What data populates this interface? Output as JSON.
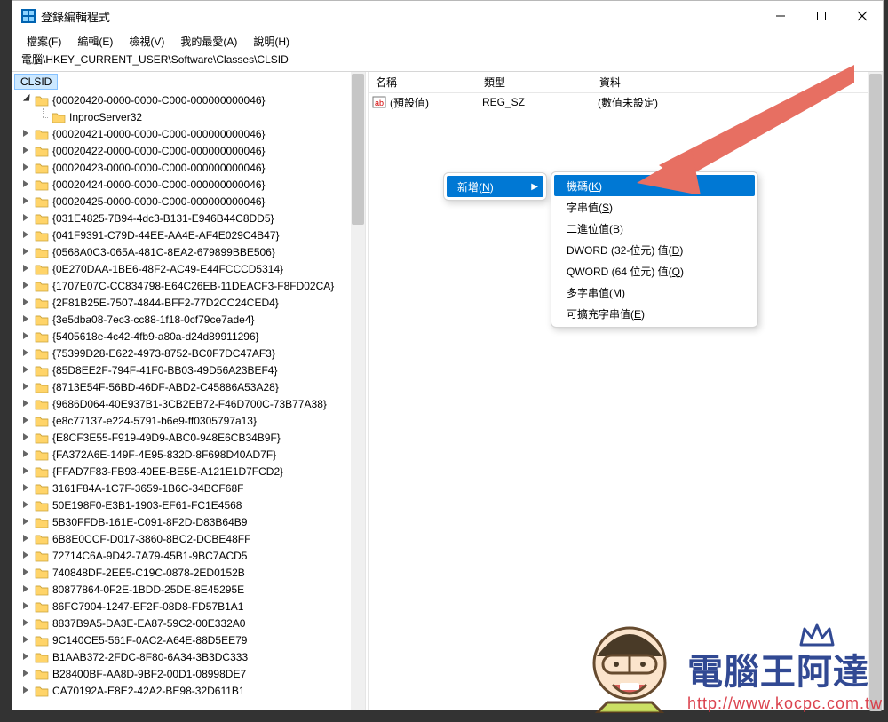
{
  "window": {
    "title": "登錄編輯程式"
  },
  "menubar": {
    "file": "檔案(F)",
    "edit": "編輯(E)",
    "view": "檢視(V)",
    "favorites": "我的最愛(A)",
    "help": "說明(H)"
  },
  "address": "電腦\\HKEY_CURRENT_USER\\Software\\Classes\\CLSID",
  "tree": {
    "selected": "CLSID",
    "items": [
      {
        "label": "{00020420-0000-0000-C000-000000000046}",
        "expanded": true,
        "exp": true
      },
      {
        "label": "InprocServer32",
        "level2": true
      },
      {
        "label": "{00020421-0000-0000-C000-000000000046}",
        "exp": true
      },
      {
        "label": "{00020422-0000-0000-C000-000000000046}",
        "exp": true
      },
      {
        "label": "{00020423-0000-0000-C000-000000000046}",
        "exp": true
      },
      {
        "label": "{00020424-0000-0000-C000-000000000046}",
        "exp": true
      },
      {
        "label": "{00020425-0000-0000-C000-000000000046}",
        "exp": true
      },
      {
        "label": "{031E4825-7B94-4dc3-B131-E946B44C8DD5}",
        "exp": true
      },
      {
        "label": "{041F9391-C79D-44EE-AA4E-AF4E029C4B47}",
        "exp": true
      },
      {
        "label": "{0568A0C3-065A-481C-8EA2-679899BBE506}",
        "exp": true
      },
      {
        "label": "{0E270DAA-1BE6-48F2-AC49-E44FCCCD5314}",
        "exp": true
      },
      {
        "label": "{1707E07C-CC834798-E64C26EB-11DEACF3-F8FD02CA}",
        "exp": true
      },
      {
        "label": "{2F81B25E-7507-4844-BFF2-77D2CC24CED4}",
        "exp": true
      },
      {
        "label": "{3e5dba08-7ec3-cc88-1f18-0cf79ce7ade4}",
        "exp": true
      },
      {
        "label": "{5405618e-4c42-4fb9-a80a-d24d89911296}",
        "exp": true
      },
      {
        "label": "{75399D28-E622-4973-8752-BC0F7DC47AF3}",
        "exp": true
      },
      {
        "label": "{85D8EE2F-794F-41F0-BB03-49D56A23BEF4}",
        "exp": true
      },
      {
        "label": "{8713E54F-56BD-46DF-ABD2-C45886A53A28}",
        "exp": true
      },
      {
        "label": "{9686D064-40E937B1-3CB2EB72-F46D700C-73B77A38}",
        "exp": true
      },
      {
        "label": "{e8c77137-e224-5791-b6e9-ff0305797a13}",
        "exp": true
      },
      {
        "label": "{E8CF3E55-F919-49D9-ABC0-948E6CB34B9F}",
        "exp": true
      },
      {
        "label": "{FA372A6E-149F-4E95-832D-8F698D40AD7F}",
        "exp": true
      },
      {
        "label": "{FFAD7F83-FB93-40EE-BE5E-A121E1D7FCD2}",
        "exp": true
      },
      {
        "label": "3161F84A-1C7F-3659-1B6C-34BCF68F",
        "exp": true
      },
      {
        "label": "50E198F0-E3B1-1903-EF61-FC1E4568",
        "exp": true
      },
      {
        "label": "5B30FFDB-161E-C091-8F2D-D83B64B9",
        "exp": true
      },
      {
        "label": "6B8E0CCF-D017-3860-8BC2-DCBE48FF",
        "exp": true
      },
      {
        "label": "72714C6A-9D42-7A79-45B1-9BC7ACD5",
        "exp": true
      },
      {
        "label": "740848DF-2EE5-C19C-0878-2ED0152B",
        "exp": true
      },
      {
        "label": "80877864-0F2E-1BDD-25DE-8E45295E",
        "exp": true
      },
      {
        "label": "86FC7904-1247-EF2F-08D8-FD57B1A1",
        "exp": true
      },
      {
        "label": "8837B9A5-DA3E-EA87-59C2-00E332A0",
        "exp": true
      },
      {
        "label": "9C140CE5-561F-0AC2-A64E-88D5EE79",
        "exp": true
      },
      {
        "label": "B1AAB372-2FDC-8F80-6A34-3B3DC333",
        "exp": true
      },
      {
        "label": "B28400BF-AA8D-9BF2-00D1-08998DE7",
        "exp": true
      },
      {
        "label": "CA70192A-E8E2-42A2-BE98-32D611B1",
        "exp": true
      }
    ]
  },
  "list": {
    "columns": {
      "name": "名稱",
      "type": "類型",
      "data": "資料"
    },
    "rows": [
      {
        "name": "(預設值)",
        "type": "REG_SZ",
        "data": "(數值未設定)"
      }
    ]
  },
  "context_menu": {
    "new": "新增",
    "new_accel": "N",
    "submenu": [
      {
        "label": "機碼",
        "accel": "K",
        "selected": true
      },
      {
        "label": "字串值",
        "accel": "S"
      },
      {
        "label": "二進位值",
        "accel": "B"
      },
      {
        "label": "DWORD (32-位元) 值",
        "accel": "D"
      },
      {
        "label": "QWORD (64 位元) 值",
        "accel": "Q"
      },
      {
        "label": "多字串值",
        "accel": "M"
      },
      {
        "label": "可擴充字串值",
        "accel": "E"
      }
    ]
  },
  "watermark": {
    "title": "電腦王阿達",
    "url": "http://www.kocpc.com.tw"
  }
}
